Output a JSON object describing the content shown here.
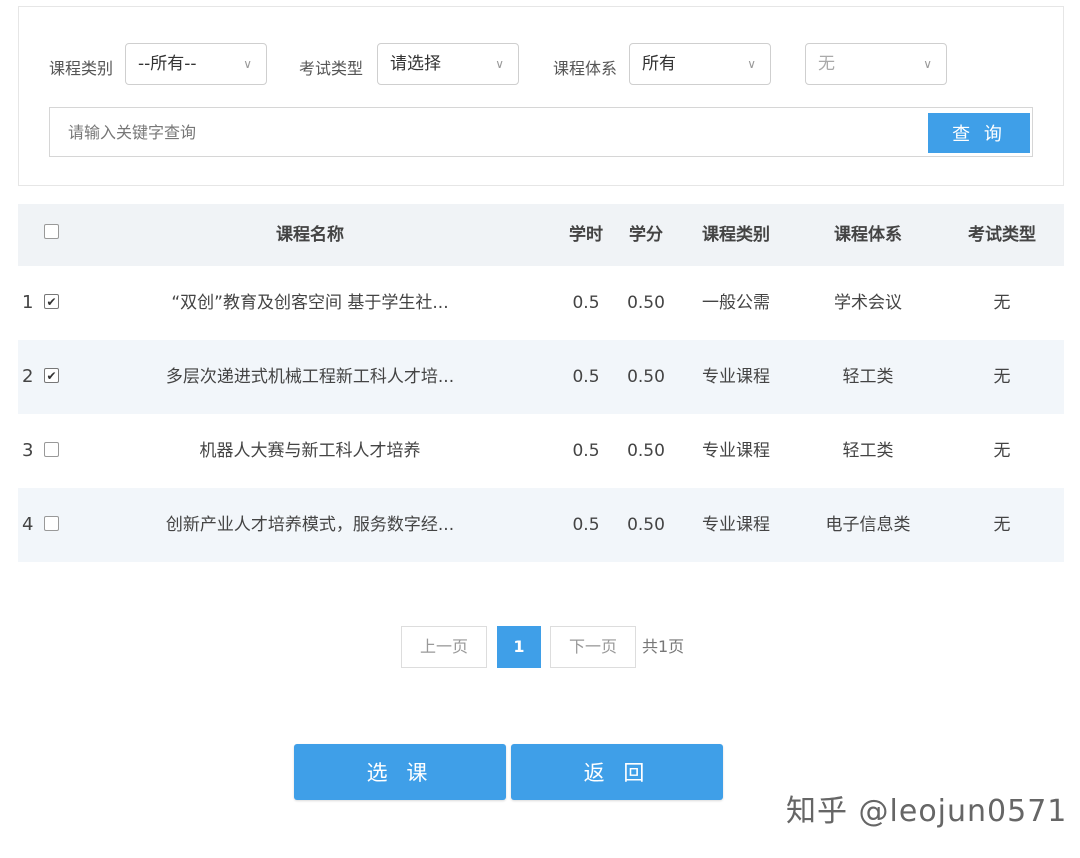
{
  "filters": {
    "course_category": {
      "label": "课程类别",
      "value": "--所有--"
    },
    "exam_type": {
      "label": "考试类型",
      "value": "请选择"
    },
    "course_system": {
      "label": "课程体系",
      "value": "所有"
    },
    "sub_system": {
      "value": "无"
    },
    "search": {
      "placeholder": "请输入关键字查询",
      "button_label": "查 询"
    }
  },
  "table": {
    "headers": {
      "name": "课程名称",
      "hours": "学时",
      "credits": "学分",
      "category": "课程类别",
      "system": "课程体系",
      "exam": "考试类型"
    },
    "rows": [
      {
        "num": "1",
        "checked": true,
        "name": "“双创”教育及创客空间 基于学生社...",
        "hours": "0.5",
        "credits": "0.50",
        "category": "一般公需",
        "system": "学术会议",
        "exam": "无"
      },
      {
        "num": "2",
        "checked": true,
        "name": "多层次递进式机械工程新工科人才培...",
        "hours": "0.5",
        "credits": "0.50",
        "category": "专业课程",
        "system": "轻工类",
        "exam": "无"
      },
      {
        "num": "3",
        "checked": false,
        "name": "机器人大赛与新工科人才培养",
        "hours": "0.5",
        "credits": "0.50",
        "category": "专业课程",
        "system": "轻工类",
        "exam": "无"
      },
      {
        "num": "4",
        "checked": false,
        "name": "创新产业人才培养模式，服务数字经...",
        "hours": "0.5",
        "credits": "0.50",
        "category": "专业课程",
        "system": "电子信息类",
        "exam": "无"
      }
    ]
  },
  "pagination": {
    "prev": "上一页",
    "current": "1",
    "next": "下一页",
    "total": "共1页"
  },
  "actions": {
    "select": "选 课",
    "back": "返 回"
  },
  "watermark": "知乎 @leojun0571",
  "colors": {
    "accent": "#3f9fe8",
    "header_bg": "#f0f3f6",
    "alt_row_bg": "#f2f6fa"
  }
}
